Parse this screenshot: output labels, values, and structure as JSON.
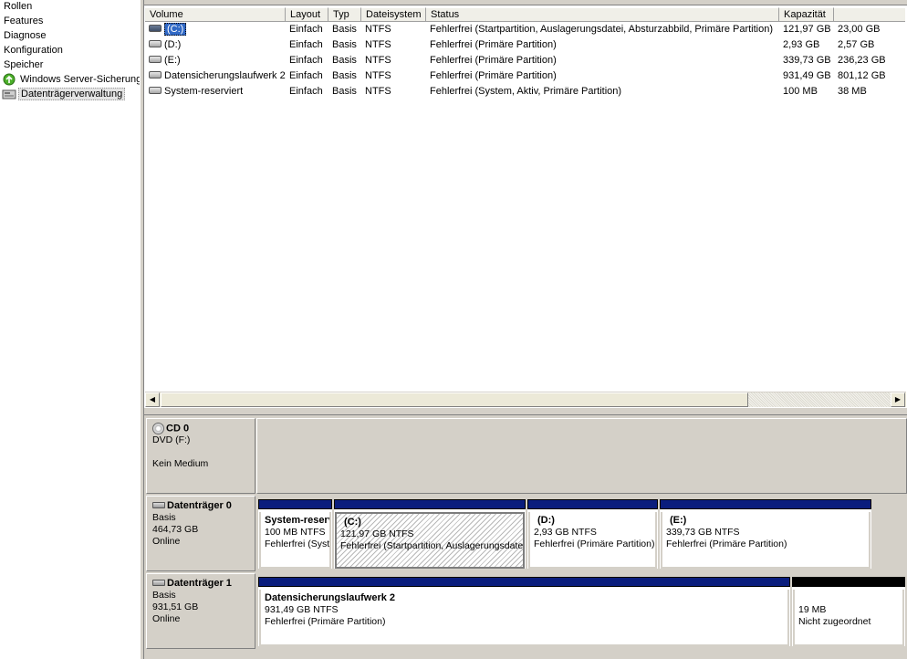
{
  "tree": {
    "items": [
      {
        "label": "Rollen",
        "icon": "none"
      },
      {
        "label": "Features",
        "icon": "none"
      },
      {
        "label": "Diagnose",
        "icon": "none"
      },
      {
        "label": "Konfiguration",
        "icon": "none"
      },
      {
        "label": "Speicher",
        "icon": "none"
      },
      {
        "label": "Windows Server-Sicherung",
        "icon": "backup-icon"
      },
      {
        "label": "Datenträgerverwaltung",
        "icon": "disk-management-icon",
        "selected": true
      }
    ]
  },
  "volume_list": {
    "columns": [
      "Volume",
      "Layout",
      "Typ",
      "Dateisystem",
      "Status",
      "Kapazität",
      ""
    ],
    "rows": [
      {
        "volume": "(C:)",
        "layout": "Einfach",
        "typ": "Basis",
        "dateisystem": "NTFS",
        "status": "Fehlerfrei (Startpartition, Auslagerungsdatei, Absturzabbild, Primäre Partition)",
        "kapazitaet": "121,97 GB",
        "frei": "23,00 GB",
        "selected": true
      },
      {
        "volume": "(D:)",
        "layout": "Einfach",
        "typ": "Basis",
        "dateisystem": "NTFS",
        "status": "Fehlerfrei (Primäre Partition)",
        "kapazitaet": "2,93 GB",
        "frei": "2,57 GB"
      },
      {
        "volume": "(E:)",
        "layout": "Einfach",
        "typ": "Basis",
        "dateisystem": "NTFS",
        "status": "Fehlerfrei (Primäre Partition)",
        "kapazitaet": "339,73 GB",
        "frei": "236,23 GB"
      },
      {
        "volume": "Datensicherungslaufwerk 2",
        "layout": "Einfach",
        "typ": "Basis",
        "dateisystem": "NTFS",
        "status": "Fehlerfrei (Primäre Partition)",
        "kapazitaet": "931,49 GB",
        "frei": "801,12 GB"
      },
      {
        "volume": "System-reserviert",
        "layout": "Einfach",
        "typ": "Basis",
        "dateisystem": "NTFS",
        "status": "Fehlerfrei (System, Aktiv, Primäre Partition)",
        "kapazitaet": "100 MB",
        "frei": "38 MB"
      }
    ]
  },
  "scrollbar": {
    "left_arrow": "◀",
    "right_arrow": "▶"
  },
  "disks": [
    {
      "title": "CD 0",
      "line1": "DVD (F:)",
      "line2": "",
      "line3": "Kein Medium",
      "partitions": []
    },
    {
      "title": "Datenträger 0",
      "line1": "Basis",
      "line2": "464,73 GB",
      "line3": "Online",
      "partitions": [
        {
          "name": "System-reserviert",
          "size": "100 MB NTFS",
          "status": "Fehlerfrei (System, Aktiv, Primäre Partition)"
        },
        {
          "name": "(C:)",
          "size": "121,97 GB NTFS",
          "status": "Fehlerfrei (Startpartition, Auslagerungsdatei, Absturzabbild, Primäre Partition)"
        },
        {
          "name": "(D:)",
          "size": "2,93 GB NTFS",
          "status": "Fehlerfrei (Primäre Partition)"
        },
        {
          "name": "(E:)",
          "size": "339,73 GB NTFS",
          "status": "Fehlerfrei (Primäre Partition)"
        }
      ]
    },
    {
      "title": "Datenträger 1",
      "line1": "Basis",
      "line2": "931,51 GB",
      "line3": "Online",
      "partitions": [
        {
          "name": "Datensicherungslaufwerk 2",
          "size": "931,49 GB NTFS",
          "status": "Fehlerfrei (Primäre Partition)"
        },
        {
          "name": "",
          "size": "19 MB",
          "status": "Nicht zugeordnet"
        }
      ]
    }
  ],
  "colors": {
    "primary_partition_bar": "#0a1d7d",
    "unallocated_bar": "#000000",
    "selection": "#3169c6"
  }
}
